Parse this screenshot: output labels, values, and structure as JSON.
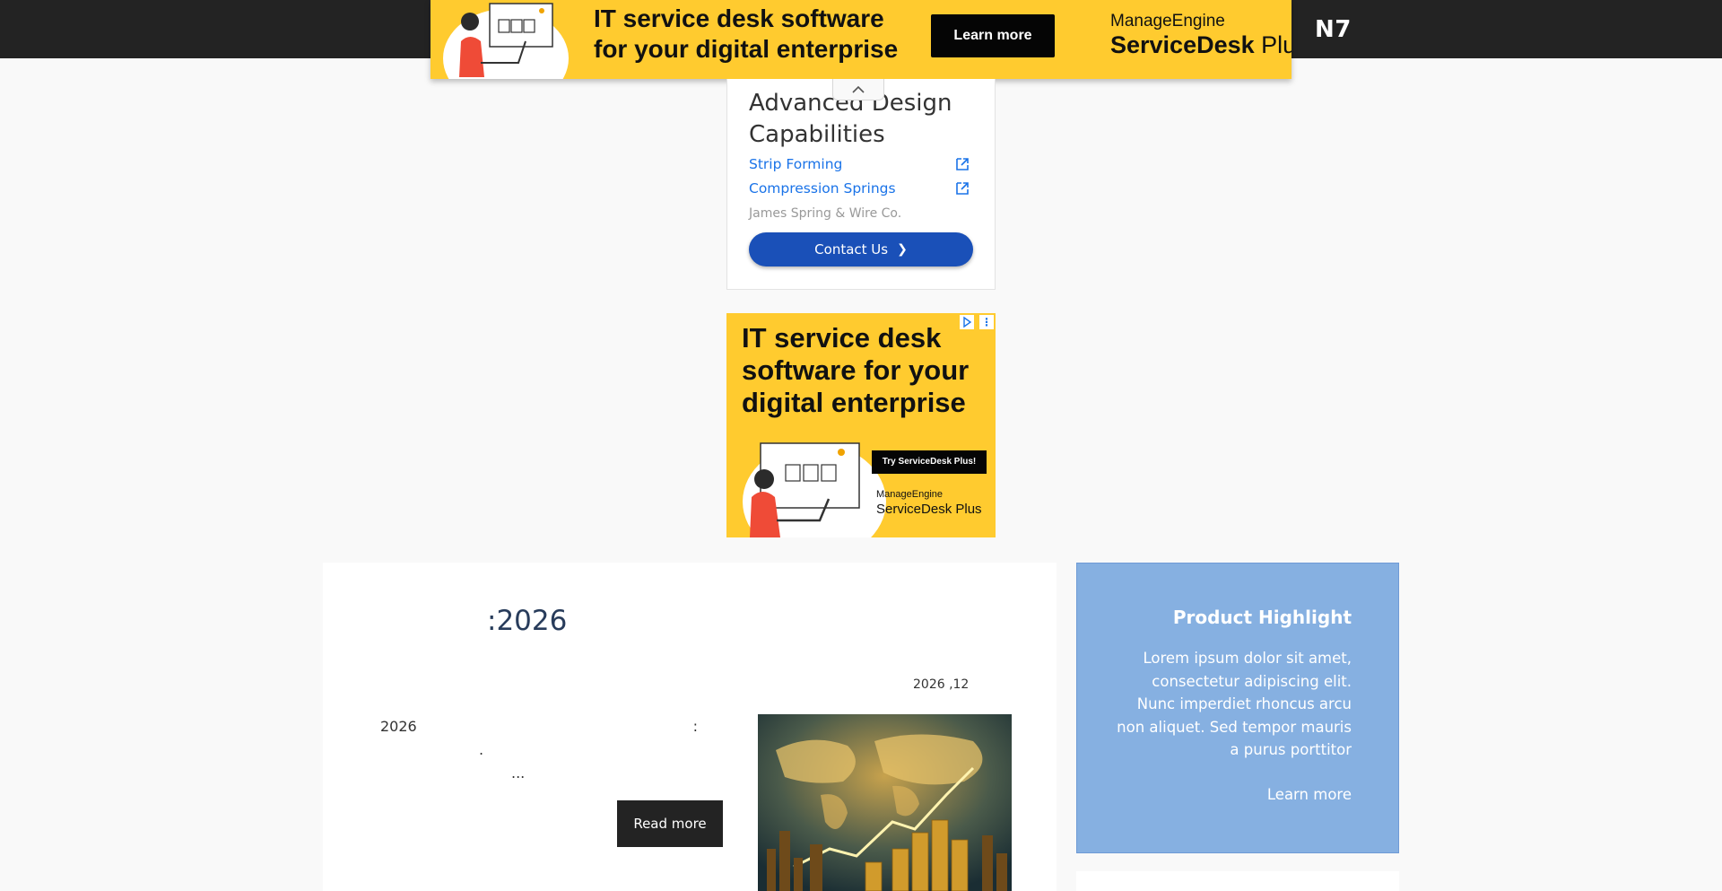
{
  "site": {
    "logo": "N7"
  },
  "top_ad": {
    "headline_line1": "IT service desk software",
    "headline_line2": "for your digital enterprise",
    "cta": "Learn more",
    "brand_top": "ManageEngine",
    "brand_bold": "ServiceDesk",
    "brand_rest": " Plus",
    "accent_color": "#ffcb2f"
  },
  "advert_card": {
    "title": "Advanced Design Capabilities",
    "links": [
      {
        "label": "Strip Forming",
        "icon": "external-link-icon"
      },
      {
        "label": "Compression Springs",
        "icon": "external-link-icon"
      }
    ],
    "company": "James Spring & Wire Co.",
    "contact_label": "Contact Us"
  },
  "side_ad": {
    "headline_line1": "IT service desk",
    "headline_line2": "software for your",
    "headline_line3": "digital enterprise",
    "cta": "Try ServiceDesk Plus!",
    "brand_top": "ManageEngine",
    "brand_bottom": "ServiceDesk Plus"
  },
  "article": {
    "title": ":2026",
    "date": "2026 ,12",
    "excerpt_year": "2026",
    "excerpt_colon": ":",
    "excerpt_period": ".",
    "excerpt_ellipsis": "...",
    "read_more": "Read more"
  },
  "promo": {
    "title": "Product Highlight",
    "body": "Lorem ipsum dolor sit amet, consectetur adipiscing elit. Nunc imperdiet rhoncus arcu non aliquet. Sed tempor mauris a purus porttitor",
    "link": "Learn more",
    "bg_color": "#86b0e1"
  }
}
